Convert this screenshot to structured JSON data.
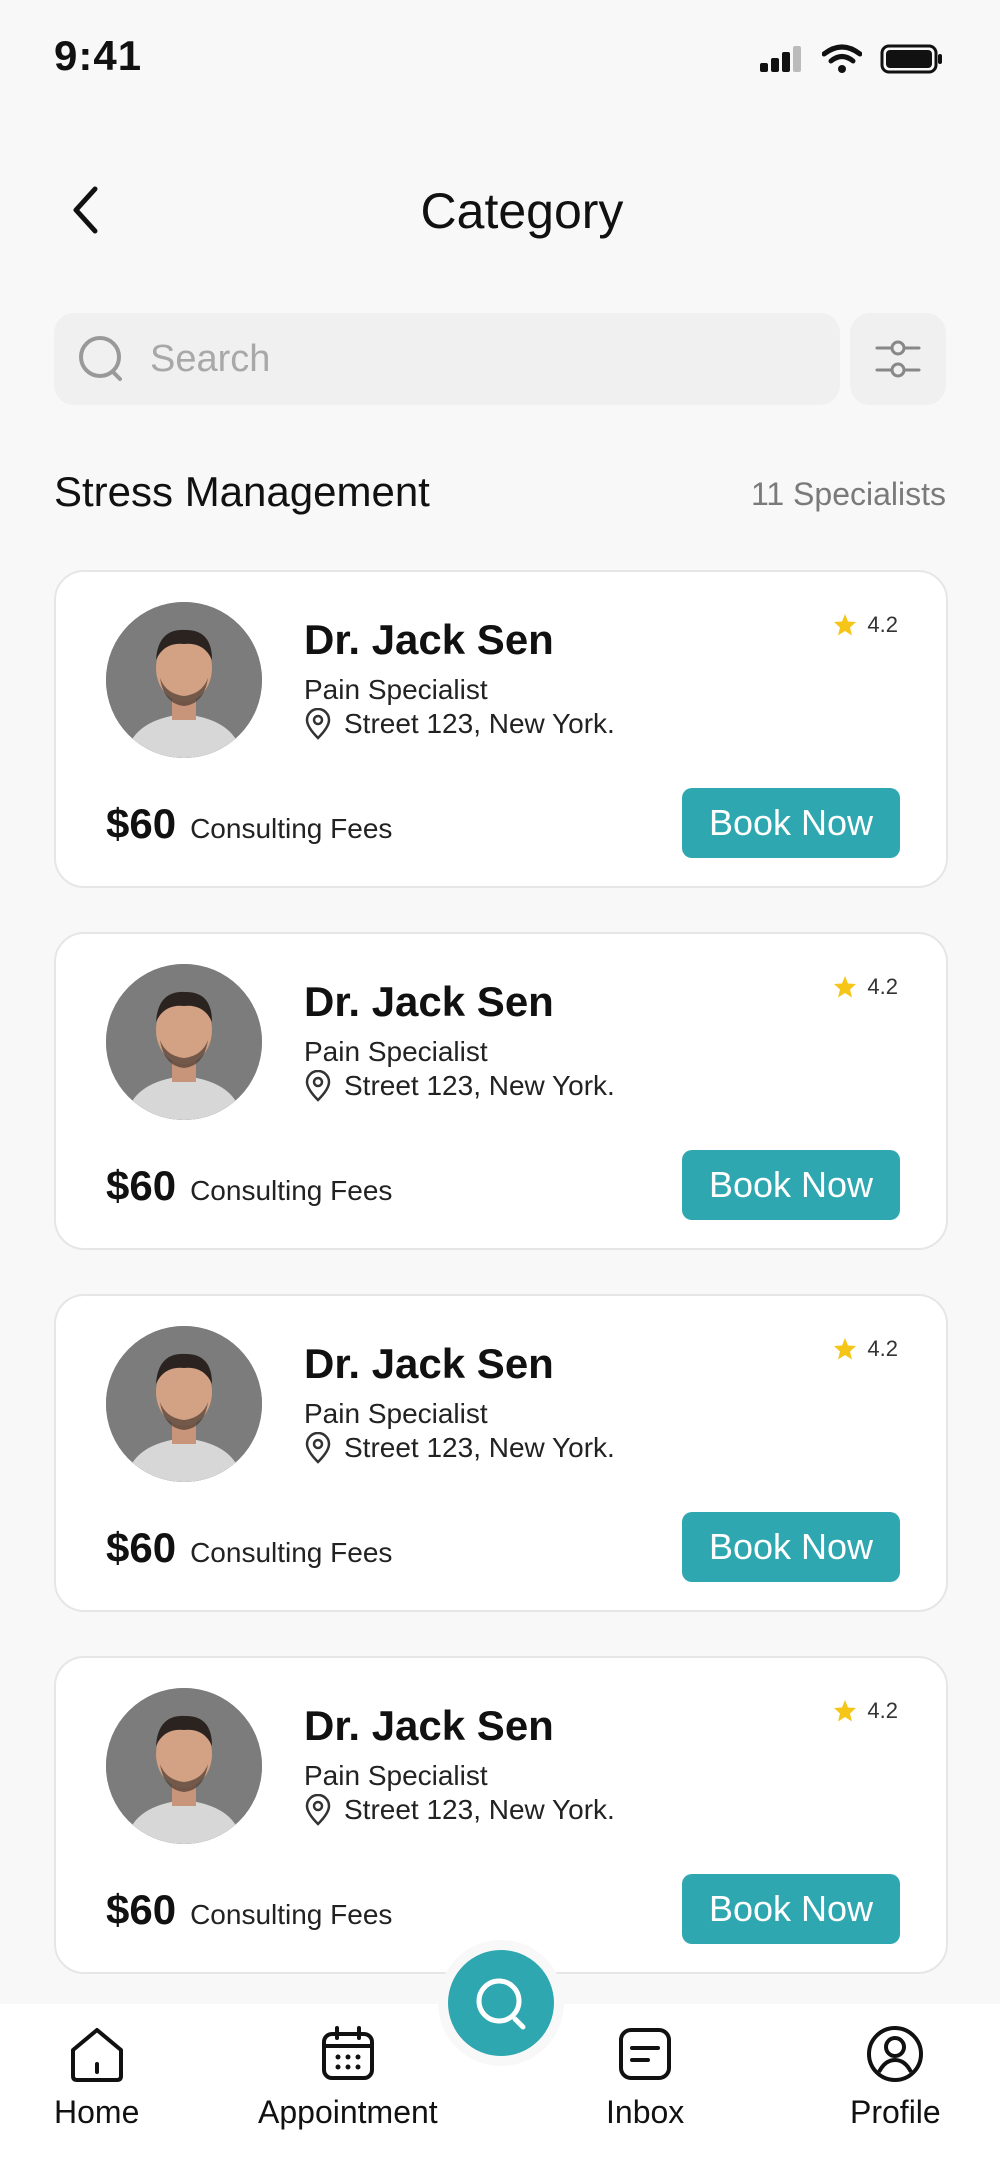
{
  "status_bar": {
    "time": "9:41"
  },
  "header": {
    "title": "Category",
    "back_icon": "chevron-left-icon"
  },
  "search": {
    "placeholder": "Search",
    "value": ""
  },
  "section": {
    "title": "Stress Management",
    "count": "11 Specialists"
  },
  "doctors": [
    {
      "name": "Dr. Jack Sen",
      "specialty": "Pain Specialist",
      "location": "Street 123, New York.",
      "rating": "4.2",
      "price": "$60",
      "fee_label": "Consulting Fees",
      "button": "Book Now"
    },
    {
      "name": "Dr. Jack Sen",
      "specialty": "Pain Specialist",
      "location": "Street 123, New York.",
      "rating": "4.2",
      "price": "$60",
      "fee_label": "Consulting Fees",
      "button": "Book Now"
    },
    {
      "name": "Dr. Jack Sen",
      "specialty": "Pain Specialist",
      "location": "Street 123, New York.",
      "rating": "4.2",
      "price": "$60",
      "fee_label": "Consulting Fees",
      "button": "Book Now"
    },
    {
      "name": "Dr. Jack Sen",
      "specialty": "Pain Specialist",
      "location": "Street 123, New York.",
      "rating": "4.2",
      "price": "$60",
      "fee_label": "Consulting Fees",
      "button": "Book Now"
    }
  ],
  "nav": {
    "home": "Home",
    "appointment": "Appointment",
    "inbox": "Inbox",
    "profile": "Profile"
  },
  "colors": {
    "accent": "#2ea7b0",
    "star": "#f5c518",
    "background": "#f8f8f8"
  }
}
